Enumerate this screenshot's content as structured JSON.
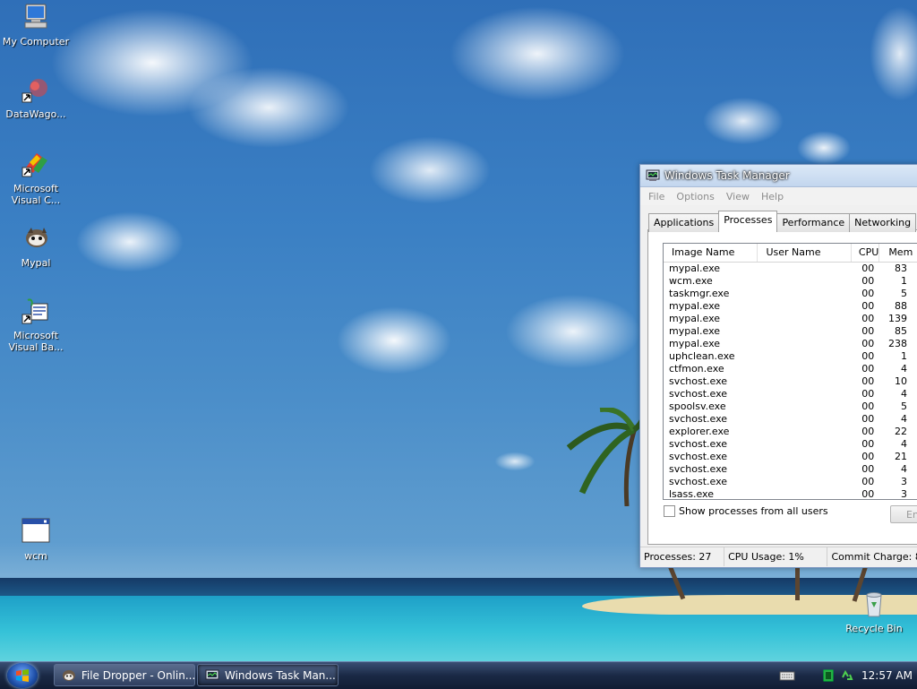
{
  "desktop": {
    "icons": [
      {
        "label": "My Computer",
        "icon": "my-computer-icon"
      },
      {
        "label": "DataWago...",
        "icon": "datawagon-shortcut-icon"
      },
      {
        "label": "Microsoft Visual C...",
        "icon": "visual-c-shortcut-icon"
      },
      {
        "label": "Mypal",
        "icon": "mypal-icon"
      },
      {
        "label": "Microsoft Visual Ba...",
        "icon": "visual-basic-shortcut-icon"
      },
      {
        "label": "wcm",
        "icon": "window-icon"
      },
      {
        "label": "Recycle Bin",
        "icon": "recycle-bin-icon"
      }
    ]
  },
  "task_manager": {
    "title": "Windows Task Manager",
    "menu": [
      "File",
      "Options",
      "View",
      "Help"
    ],
    "tabs": [
      "Applications",
      "Processes",
      "Performance",
      "Networking"
    ],
    "active_tab": "Processes",
    "columns": [
      "Image Name",
      "User Name",
      "CPU",
      "Mem"
    ],
    "processes": [
      {
        "name": "mypal.exe",
        "user": "",
        "cpu": "00",
        "mem": "83"
      },
      {
        "name": "wcm.exe",
        "user": "",
        "cpu": "00",
        "mem": "1"
      },
      {
        "name": "taskmgr.exe",
        "user": "",
        "cpu": "00",
        "mem": "5"
      },
      {
        "name": "mypal.exe",
        "user": "",
        "cpu": "00",
        "mem": "88"
      },
      {
        "name": "mypal.exe",
        "user": "",
        "cpu": "00",
        "mem": "139"
      },
      {
        "name": "mypal.exe",
        "user": "",
        "cpu": "00",
        "mem": "85"
      },
      {
        "name": "mypal.exe",
        "user": "",
        "cpu": "00",
        "mem": "238"
      },
      {
        "name": "uphclean.exe",
        "user": "",
        "cpu": "00",
        "mem": "1"
      },
      {
        "name": "ctfmon.exe",
        "user": "",
        "cpu": "00",
        "mem": "4"
      },
      {
        "name": "svchost.exe",
        "user": "",
        "cpu": "00",
        "mem": "10"
      },
      {
        "name": "svchost.exe",
        "user": "",
        "cpu": "00",
        "mem": "4"
      },
      {
        "name": "spoolsv.exe",
        "user": "",
        "cpu": "00",
        "mem": "5"
      },
      {
        "name": "svchost.exe",
        "user": "",
        "cpu": "00",
        "mem": "4"
      },
      {
        "name": "explorer.exe",
        "user": "",
        "cpu": "00",
        "mem": "22"
      },
      {
        "name": "svchost.exe",
        "user": "",
        "cpu": "00",
        "mem": "4"
      },
      {
        "name": "svchost.exe",
        "user": "",
        "cpu": "00",
        "mem": "21"
      },
      {
        "name": "svchost.exe",
        "user": "",
        "cpu": "00",
        "mem": "4"
      },
      {
        "name": "svchost.exe",
        "user": "",
        "cpu": "00",
        "mem": "3"
      },
      {
        "name": "lsass.exe",
        "user": "",
        "cpu": "00",
        "mem": "3"
      }
    ],
    "show_all_label": "Show processes from all users",
    "end_button_label": "En",
    "status": {
      "processes": "Processes: 27",
      "cpu": "CPU Usage: 1%",
      "commit": "Commit Charge: 8"
    }
  },
  "taskbar": {
    "buttons": [
      {
        "label": "File Dropper - Onlin...",
        "icon": "mypal-icon"
      },
      {
        "label": "Windows Task Man...",
        "icon": "task-manager-icon"
      }
    ],
    "clock": "12:57 AM",
    "tray_icons": [
      "keyboard-icon",
      "network-icon",
      "recycle-tray-icon"
    ]
  }
}
